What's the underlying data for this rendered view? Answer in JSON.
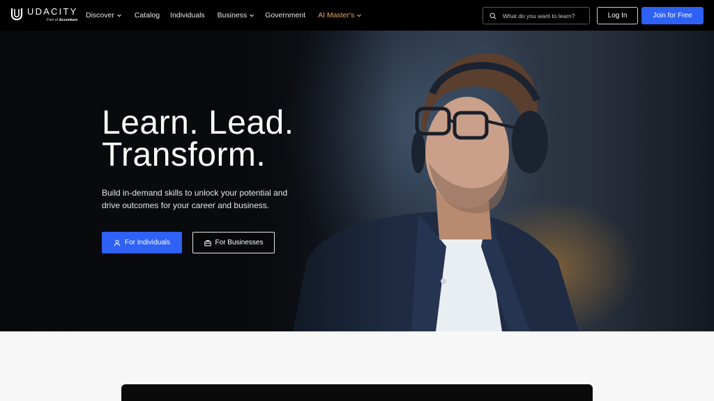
{
  "header": {
    "logo": {
      "word": "UDACITY",
      "sub_prefix": "Part of",
      "sub_brand": "Accenture",
      "icon": "udacity-logo-icon"
    },
    "nav": [
      {
        "label": "Discover",
        "has_dropdown": true
      },
      {
        "label": "Catalog",
        "has_dropdown": false
      },
      {
        "label": "Individuals",
        "has_dropdown": false
      },
      {
        "label": "Business",
        "has_dropdown": true
      },
      {
        "label": "Government",
        "has_dropdown": false
      },
      {
        "label": "AI Master's",
        "has_dropdown": true,
        "accent": true
      }
    ],
    "search": {
      "placeholder": "What do you want to learn?",
      "value": "",
      "icon": "search-icon"
    },
    "login_label": "Log In",
    "join_label": "Join for Free"
  },
  "hero": {
    "title_line1": "Learn. Lead.",
    "title_line2": "Transform.",
    "subtitle": "Build in-demand skills to unlock your potential and drive outcomes for your career and business.",
    "cta_individuals": {
      "label": "For Individuals",
      "icon": "user-icon"
    },
    "cta_businesses": {
      "label": "For Businesses",
      "icon": "briefcase-icon"
    }
  },
  "colors": {
    "brand_blue": "#2f61f5",
    "accent_orange": "#f0a860",
    "header_bg": "#000000",
    "page_bg": "#f7f7f8"
  }
}
